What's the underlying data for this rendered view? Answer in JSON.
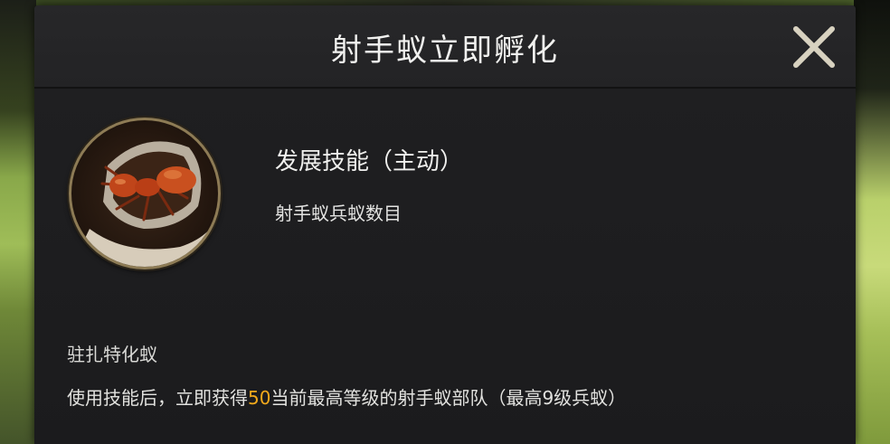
{
  "dialog": {
    "title": "射手蚁立即孵化",
    "close_icon": "close-icon"
  },
  "skill": {
    "portrait_icon": "fire-ant-icon",
    "name": "发展技能（主动）",
    "description": "射手蚁兵蚁数目"
  },
  "effect": {
    "title": "驻扎特化蚁",
    "text_before": "使用技能后，立即获得",
    "amount": "50",
    "text_after": "当前最高等级的射手蚁部队（最高9级兵蚁）"
  },
  "colors": {
    "highlight": "#f2a91b",
    "dialog_bg": "#1d1d1f",
    "portrait_border": "#8d7b55"
  }
}
